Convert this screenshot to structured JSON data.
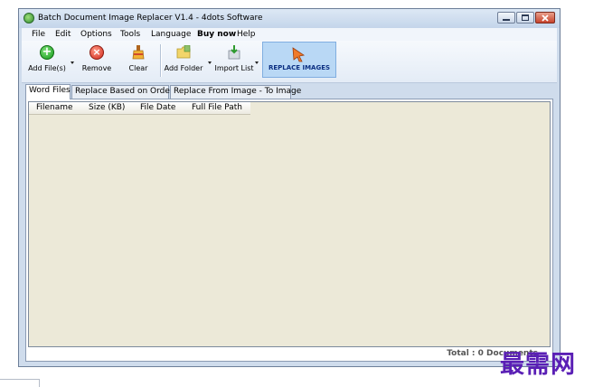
{
  "window": {
    "title": "Batch Document Image Replacer V1.4 - 4dots Software"
  },
  "menu": {
    "items": [
      "File",
      "Edit",
      "Options",
      "Tools",
      "Language",
      "Buy now",
      "Help"
    ]
  },
  "toolbar": {
    "add_files": "Add File(s)",
    "remove": "Remove",
    "clear": "Clear",
    "add_folder": "Add Folder",
    "import_list": "Import List",
    "replace_images": "REPLACE IMAGES"
  },
  "tabs": [
    "Word Files",
    "Replace Based on Order",
    "Replace From Image - To Image"
  ],
  "table": {
    "columns": [
      "Filename",
      "Size (KB)",
      "File Date",
      "Full File Path"
    ]
  },
  "status": {
    "total": "Total : 0 Documents"
  },
  "watermark": "最需网",
  "colors": {
    "accent": "#0b2f82",
    "watermark": "#5a1fb5"
  }
}
